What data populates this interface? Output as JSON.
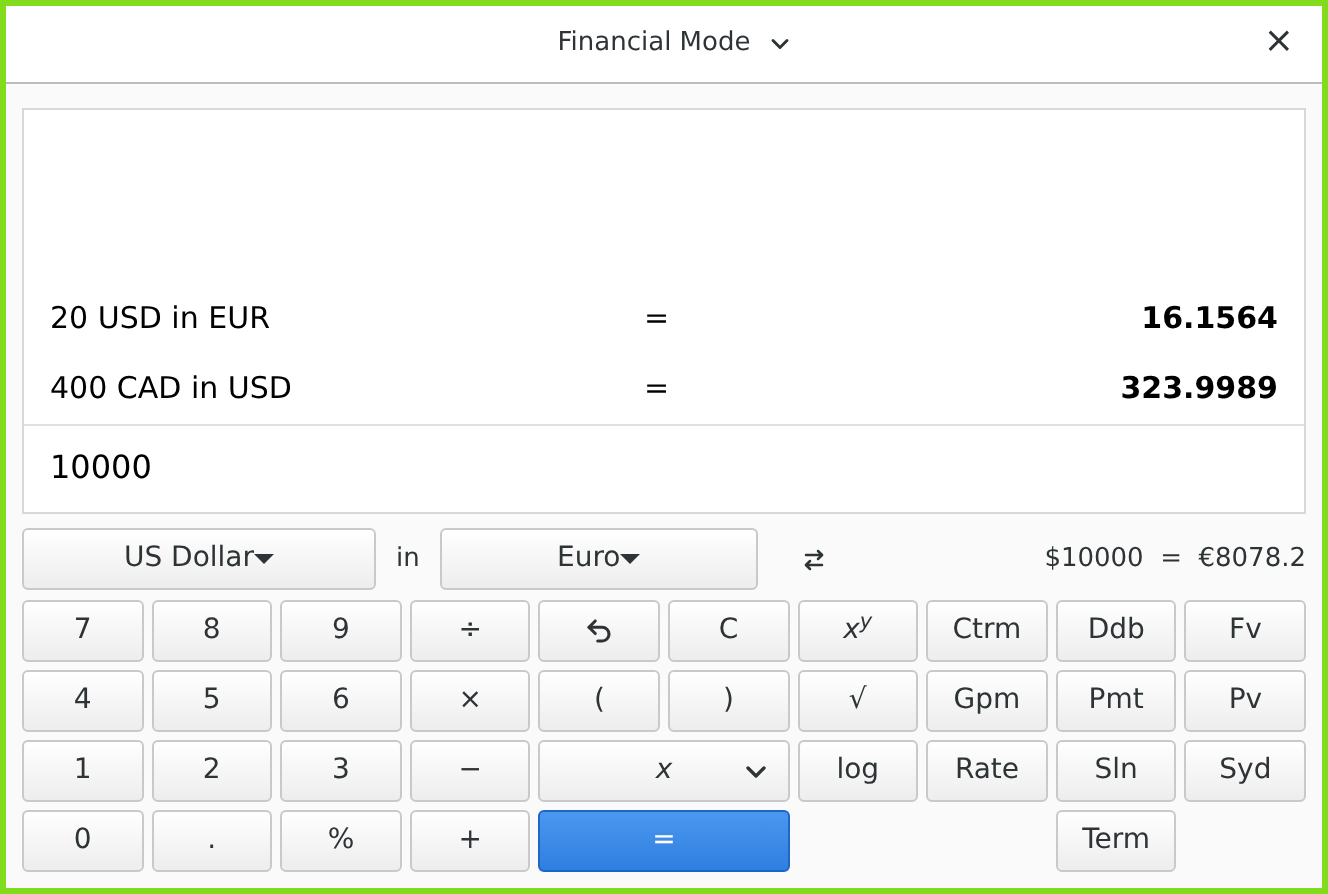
{
  "window": {
    "title": "Financial Mode",
    "close": "×"
  },
  "history": [
    {
      "expression": "20 USD in EUR",
      "equals": "=",
      "result": "16.1564"
    },
    {
      "expression": "400 CAD in USD",
      "equals": "=",
      "result": "323.9989"
    }
  ],
  "input": "10000",
  "converter": {
    "from": "US Dollar",
    "in": "in",
    "to": "Euro",
    "result": "$10000  =  €8078.2"
  },
  "keys": [
    {
      "kind": "key",
      "label": "7"
    },
    {
      "kind": "key",
      "label": "8"
    },
    {
      "kind": "key",
      "label": "9"
    },
    {
      "kind": "key",
      "label": "÷"
    },
    {
      "kind": "backspace"
    },
    {
      "kind": "key",
      "label": "C"
    },
    {
      "kind": "key",
      "label": "x$^{y}$",
      "italic": true
    },
    {
      "kind": "key",
      "label": "Ctrm"
    },
    {
      "kind": "key",
      "label": "Ddb"
    },
    {
      "kind": "key",
      "label": "Fv"
    },
    {
      "kind": "key",
      "label": "4"
    },
    {
      "kind": "key",
      "label": "5"
    },
    {
      "kind": "key",
      "label": "6"
    },
    {
      "kind": "key",
      "label": "×"
    },
    {
      "kind": "key",
      "label": "("
    },
    {
      "kind": "key",
      "label": ")"
    },
    {
      "kind": "key",
      "label": "√"
    },
    {
      "kind": "key",
      "label": "Gpm"
    },
    {
      "kind": "key",
      "label": "Pmt"
    },
    {
      "kind": "key",
      "label": "Pv"
    },
    {
      "kind": "key",
      "label": "1"
    },
    {
      "kind": "key",
      "label": "2"
    },
    {
      "kind": "key",
      "label": "3"
    },
    {
      "kind": "key",
      "label": "−"
    },
    {
      "kind": "dropdown",
      "label": "x",
      "italic": true
    },
    {
      "kind": "key",
      "label": "log"
    },
    {
      "kind": "key",
      "label": "Rate"
    },
    {
      "kind": "key",
      "label": "Sln"
    },
    {
      "kind": "key",
      "label": "Syd"
    },
    {
      "kind": "key",
      "label": "0"
    },
    {
      "kind": "key",
      "label": "."
    },
    {
      "kind": "key",
      "label": "%"
    },
    {
      "kind": "key",
      "label": "+"
    },
    {
      "kind": "equals",
      "label": "="
    },
    {
      "kind": "blank"
    },
    {
      "kind": "blank"
    },
    {
      "kind": "key",
      "label": "Term"
    },
    {
      "kind": "blank"
    }
  ]
}
